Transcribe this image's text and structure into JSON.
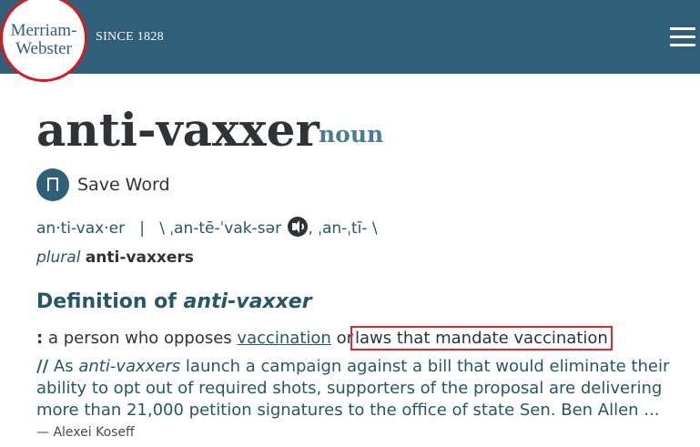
{
  "header": {
    "logo_line1": "Merriam-",
    "logo_line2": "Webster",
    "tagline": "SINCE 1828"
  },
  "entry": {
    "headword": "anti-vaxxer",
    "part_of_speech": "noun",
    "save_label": "Save Word",
    "syllables": "an·ti-vax·er",
    "separator": "|",
    "pron_open": "\\",
    "pron_1": "ˌan-tē-ˈvak-sər",
    "pron_sep": ",",
    "pron_2": "ˌan-ˌtī-",
    "pron_close": "\\",
    "plural_label": "plural",
    "plural_form": "anti-vaxxers"
  },
  "definition": {
    "heading_prefix": "Definition of ",
    "heading_term": "anti-vaxxer",
    "colon": ":",
    "text_before": "a person who opposes",
    "link_vaccination": "vaccination",
    "text_or": "or",
    "highlighted_phrase": "laws that mandate vaccination",
    "example_marker": "//",
    "example_prefix": "As",
    "example_term": "anti-vaxxers",
    "example_rest": "launch a campaign against a bill that would eliminate their ability to opt out of required shots, supporters of the proposal are delivering more than 21,000 petition signatures to the office of state Sen. Ben Allen ...",
    "author": "— Alexei Koseff"
  },
  "colors": {
    "header_bg": "#305f7a",
    "logo_ring": "#d71920",
    "accent_text": "#265667",
    "highlight_box": "#e0262d"
  },
  "icons": [
    "hamburger-menu-icon",
    "bookmark-icon",
    "audio-speaker-icon"
  ]
}
